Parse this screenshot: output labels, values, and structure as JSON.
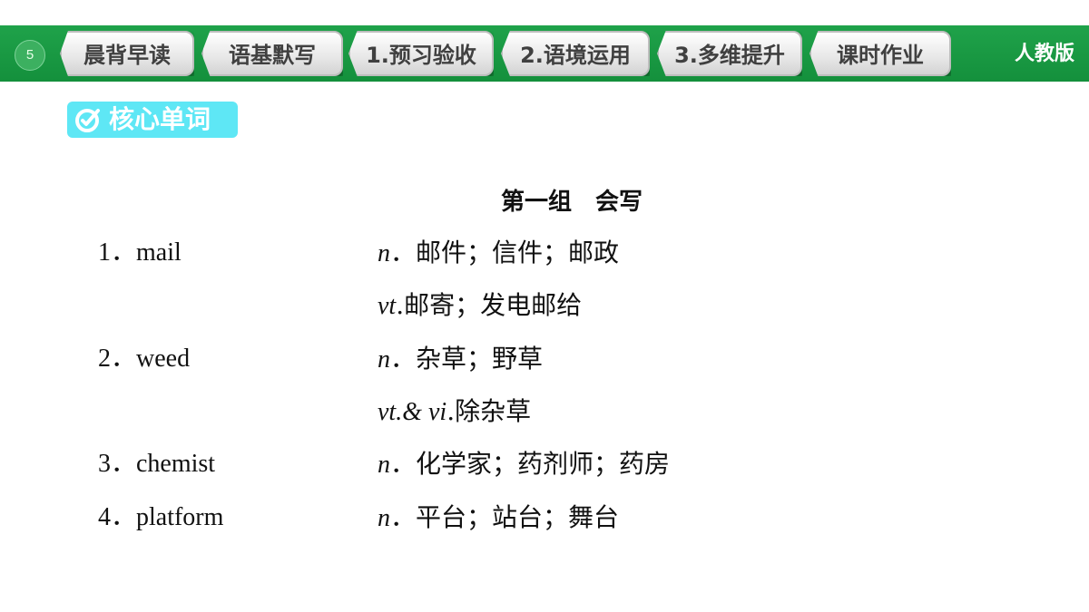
{
  "nav": {
    "page_number": "5",
    "tabs": [
      {
        "label": "晨背早读"
      },
      {
        "label": "语基默写"
      },
      {
        "label": "1.预习验收"
      },
      {
        "label": "2.语境运用"
      },
      {
        "label": "3.多维提升"
      },
      {
        "label": "课时作业"
      }
    ],
    "publisher": "人教版"
  },
  "section": {
    "badge_label": "核心单词",
    "group_title": "第一组　会写"
  },
  "vocab": [
    {
      "word": "1．mail",
      "pos": "n",
      "sep": "．",
      "meaning": "邮件；信件；邮政"
    },
    {
      "word": "",
      "pos": "vt",
      "sep": ".",
      "meaning": "邮寄；发电邮给"
    },
    {
      "word": "2．weed",
      "pos": "n",
      "sep": "．",
      "meaning": "杂草；野草"
    },
    {
      "word": "",
      "pos": "vt.& vi",
      "sep": ".",
      "meaning": "除杂草"
    },
    {
      "word": "3．chemist",
      "pos": "n",
      "sep": "．",
      "meaning": "化学家；药剂师；药房"
    },
    {
      "word": "4．platform",
      "pos": "n",
      "sep": "．",
      "meaning": "平台；站台；舞台"
    }
  ],
  "colors": {
    "bar_green": "#1fa24a",
    "badge_cyan": "#5ee7f5"
  }
}
